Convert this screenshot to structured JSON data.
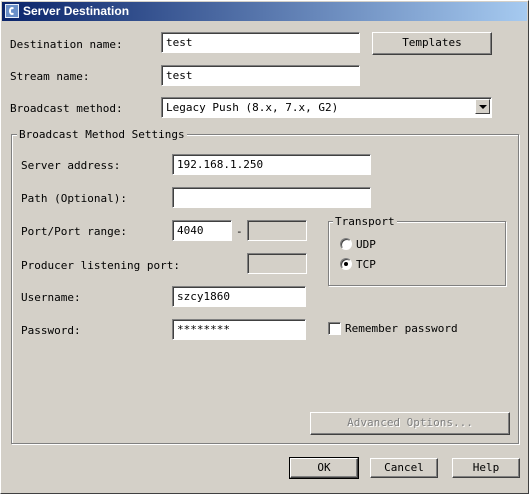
{
  "window": {
    "title": "Server Destination"
  },
  "destination": {
    "label": "Destination name:",
    "value": "test"
  },
  "templates_button": "Templates",
  "stream": {
    "label": "Stream name:",
    "value": "test"
  },
  "broadcast": {
    "label": "Broadcast method:",
    "value": "Legacy Push (8.x, 7.x, G2)"
  },
  "settings": {
    "title": "Broadcast Method Settings",
    "server_address": {
      "label": "Server address:",
      "value": "192.168.1.250"
    },
    "path": {
      "label": "Path (Optional):",
      "value": ""
    },
    "port": {
      "label": "Port/Port range:",
      "value": "4040",
      "separator": "-",
      "end_value": ""
    },
    "producer_port": {
      "label": "Producer listening port:",
      "value": ""
    },
    "username": {
      "label": "Username:",
      "value": "szcy1860"
    },
    "password": {
      "label": "Password:",
      "value": "********"
    },
    "remember_password": {
      "label": "Remember password",
      "checked": false
    },
    "transport": {
      "title": "Transport",
      "options": [
        {
          "label": "UDP",
          "checked": false
        },
        {
          "label": "TCP",
          "checked": true
        }
      ]
    },
    "advanced_button": "Advanced Options..."
  },
  "buttons": {
    "ok": "OK",
    "cancel": "Cancel",
    "help": "Help"
  }
}
